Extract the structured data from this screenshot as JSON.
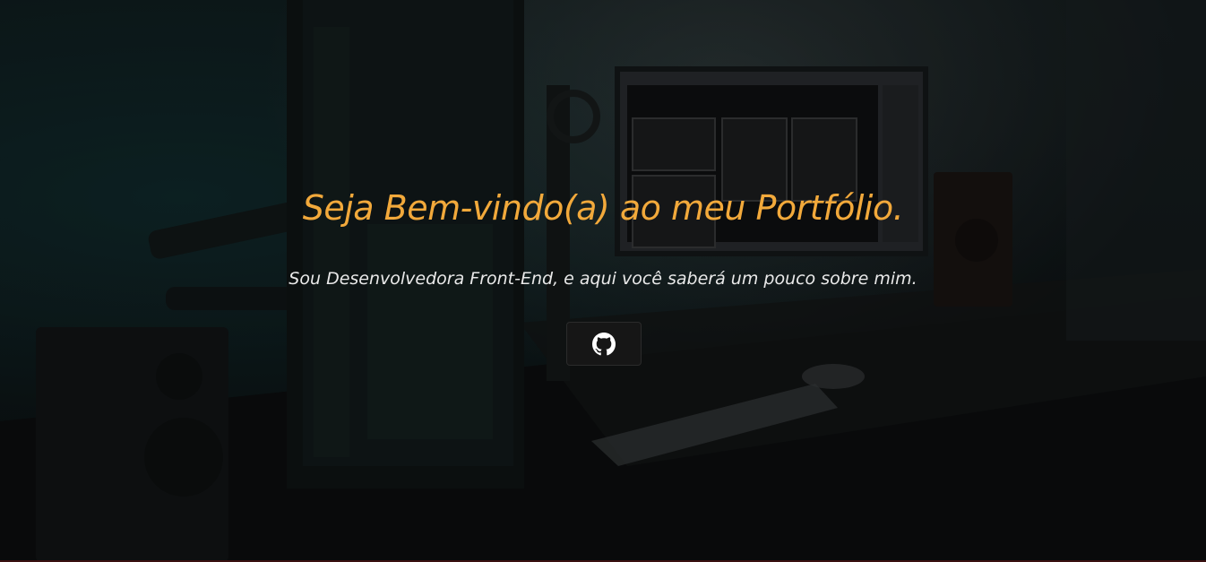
{
  "hero": {
    "title": "Seja Bem-vindo(a) ao meu Portfólio.",
    "subtitle": "Sou Desenvolvedora Front-End, e aqui você saberá um pouco sobre mim.",
    "github_button": {
      "icon": "github-icon"
    }
  },
  "colors": {
    "title": "#f2a93b",
    "subtitle": "#e9e9e9",
    "button_bg": "#161616"
  }
}
